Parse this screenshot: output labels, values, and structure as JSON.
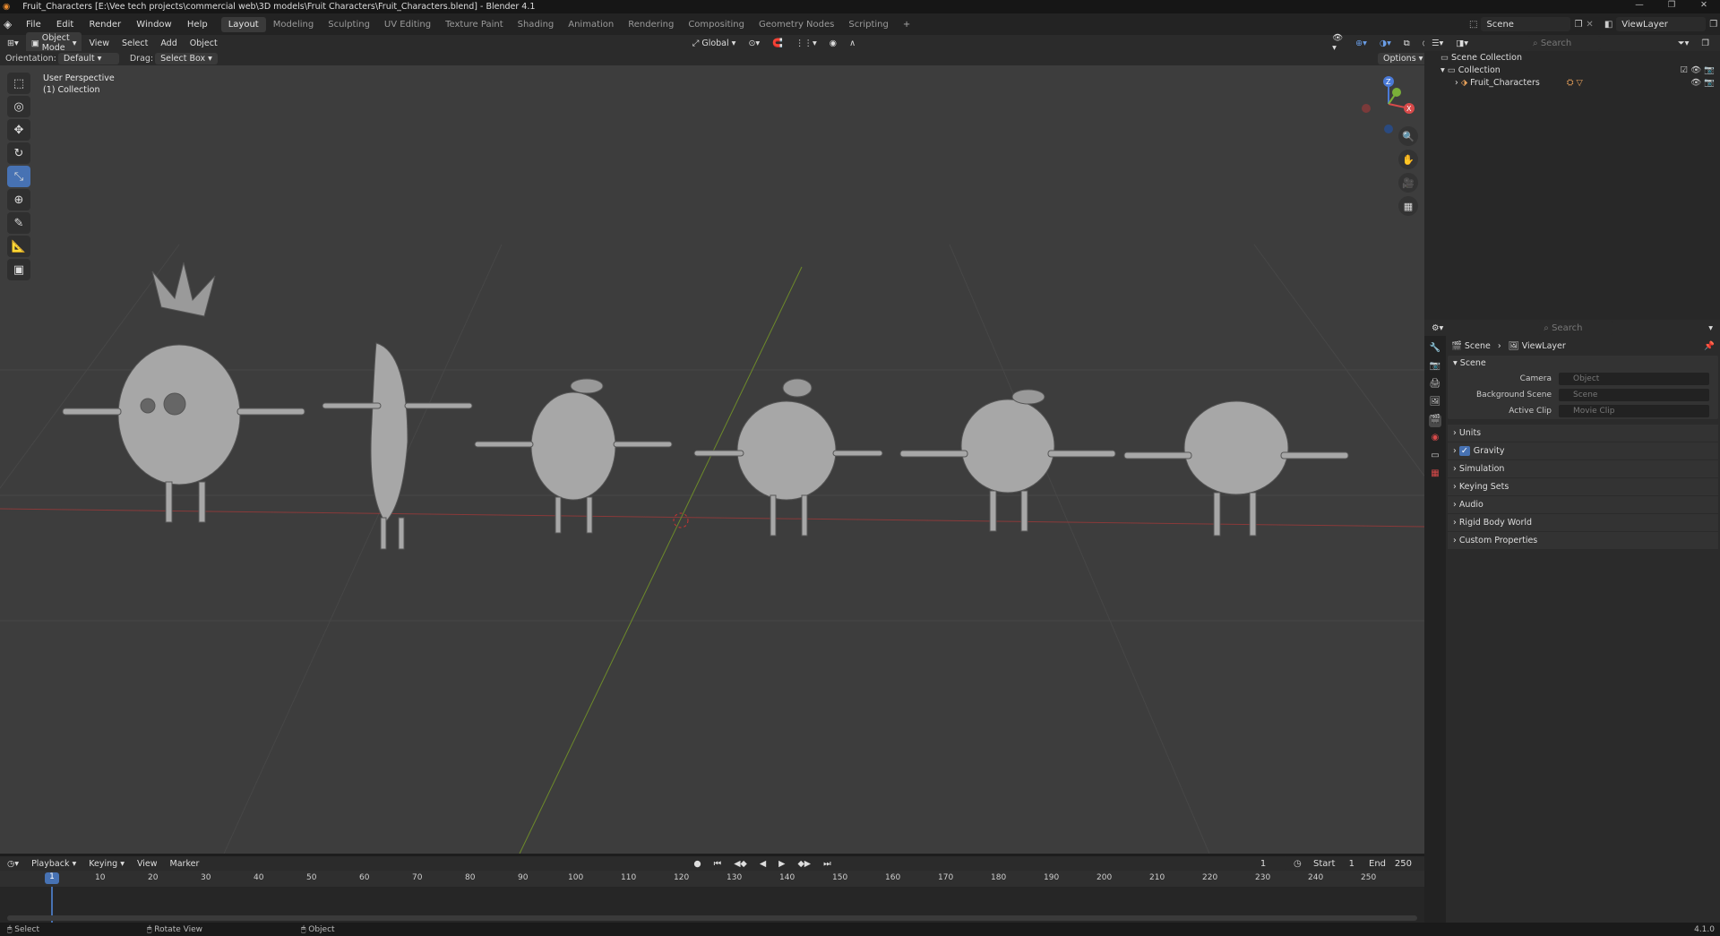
{
  "window": {
    "title": "Fruit_Characters [E:\\Vee tech projects\\commercial web\\3D models\\Fruit Characters\\Fruit_Characters.blend] - Blender 4.1"
  },
  "menu": [
    "File",
    "Edit",
    "Render",
    "Window",
    "Help"
  ],
  "workspaces": [
    "Layout",
    "Modeling",
    "Sculpting",
    "UV Editing",
    "Texture Paint",
    "Shading",
    "Animation",
    "Rendering",
    "Compositing",
    "Geometry Nodes",
    "Scripting"
  ],
  "topbar": {
    "scene": "Scene",
    "viewlayer": "ViewLayer"
  },
  "viewport": {
    "mode": "Object Mode",
    "menus": [
      "View",
      "Select",
      "Add",
      "Object"
    ],
    "orientation_label": "Orientation:",
    "orientation": "Default",
    "drag_label": "Drag:",
    "drag": "Select Box",
    "transform": "Global",
    "options": "Options",
    "info_line1": "User Perspective",
    "info_line2": "(1) Collection",
    "gizmo": {
      "z": "Z",
      "x": "X",
      "y": "Y"
    }
  },
  "outliner": {
    "search": "Search",
    "scene_collection": "Scene Collection",
    "collection": "Collection",
    "item": "Fruit_Characters"
  },
  "properties": {
    "search": "Search",
    "crumb_scene": "Scene",
    "crumb_viewlayer": "ViewLayer",
    "panel_title": "Scene",
    "camera_label": "Camera",
    "camera_placeholder": "Object",
    "bg_label": "Background Scene",
    "bg_placeholder": "Scene",
    "clip_label": "Active Clip",
    "clip_placeholder": "Movie Clip",
    "subpanels": [
      "Units",
      "Gravity",
      "Simulation",
      "Keying Sets",
      "Audio",
      "Rigid Body World",
      "Custom Properties"
    ]
  },
  "timeline": {
    "menus": [
      "Playback",
      "Keying",
      "View",
      "Marker"
    ],
    "current_frame": "1",
    "start_label": "Start",
    "start": "1",
    "end_label": "End",
    "end": "250",
    "ticks": [
      "1",
      "10",
      "20",
      "30",
      "40",
      "50",
      "60",
      "70",
      "80",
      "90",
      "100",
      "110",
      "120",
      "130",
      "140",
      "150",
      "160",
      "170",
      "180",
      "190",
      "200",
      "210",
      "220",
      "230",
      "240",
      "250"
    ]
  },
  "status": {
    "select": "Select",
    "rotate": "Rotate View",
    "object": "Object",
    "version": "4.1.0"
  }
}
